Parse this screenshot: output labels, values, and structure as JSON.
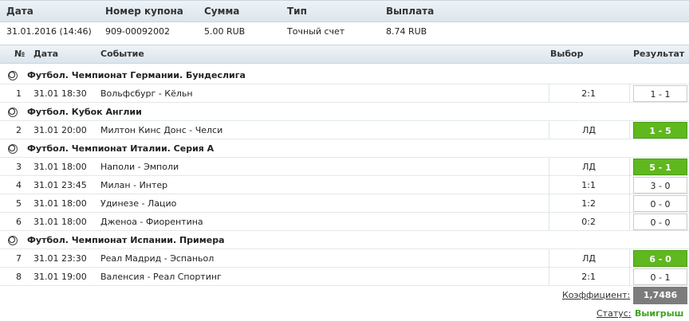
{
  "coupon": {
    "headers": [
      "Дата",
      "Номер купона",
      "Сумма",
      "Тип",
      "Выплата"
    ],
    "row": [
      "31.01.2016 (14:46)",
      "909-00092002",
      "5.00 RUB",
      "Точный счет",
      "8.74 RUB"
    ]
  },
  "events_header": [
    "№",
    "Дата",
    "Событие",
    "Выбор",
    "Результат"
  ],
  "tournaments": [
    {
      "name": "Футбол. Чемпионат Германии. Бундеслига",
      "events": [
        {
          "n": "1",
          "date": "31.01 18:30",
          "match": "Вольфсбург - Кёльн",
          "pick": "2:1",
          "result": "1 - 1",
          "win": false
        }
      ]
    },
    {
      "name": "Футбол. Кубок Англии",
      "events": [
        {
          "n": "2",
          "date": "31.01 20:00",
          "match": "Милтон Кинс Донс - Челси",
          "pick": "ЛД",
          "result": "1 - 5",
          "win": true
        }
      ]
    },
    {
      "name": "Футбол. Чемпионат Италии. Серия А",
      "events": [
        {
          "n": "3",
          "date": "31.01 18:00",
          "match": "Наполи - Эмполи",
          "pick": "ЛД",
          "result": "5 - 1",
          "win": true
        },
        {
          "n": "4",
          "date": "31.01 23:45",
          "match": "Милан - Интер",
          "pick": "1:1",
          "result": "3 - 0",
          "win": false
        },
        {
          "n": "5",
          "date": "31.01 18:00",
          "match": "Удинезе - Лацио",
          "pick": "1:2",
          "result": "0 - 0",
          "win": false
        },
        {
          "n": "6",
          "date": "31.01 18:00",
          "match": "Дженоа - Фиорентина",
          "pick": "0:2",
          "result": "0 - 0",
          "win": false
        }
      ]
    },
    {
      "name": "Футбол. Чемпионат Испании. Примера",
      "events": [
        {
          "n": "7",
          "date": "31.01 23:30",
          "match": "Реал Мадрид - Эспаньол",
          "pick": "ЛД",
          "result": "6 - 0",
          "win": true
        },
        {
          "n": "8",
          "date": "31.01 19:00",
          "match": "Валенсия - Реал Спортинг",
          "pick": "2:1",
          "result": "0 - 1",
          "win": false
        }
      ]
    }
  ],
  "summary": {
    "coef_label": "Коэффициент:",
    "coef_value": "1,7486",
    "status_label": "Статус:",
    "status_value": "Выигрыш"
  },
  "colors": {
    "win": "#5fb81e",
    "status": "#3aa51a",
    "coef_bg": "#7c7c7c"
  }
}
